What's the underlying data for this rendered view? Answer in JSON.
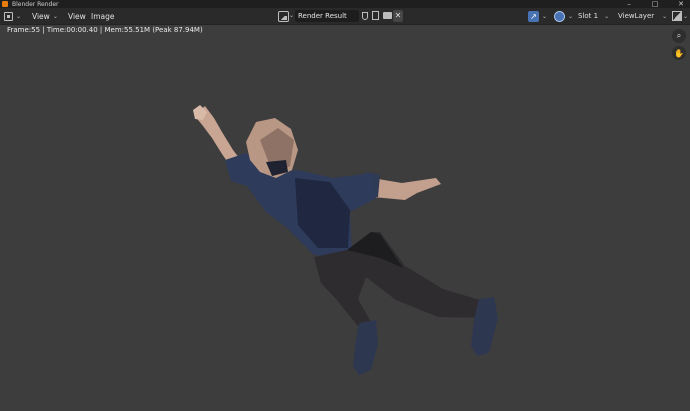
{
  "window": {
    "title": "Blender Render",
    "controls": [
      "–",
      "□",
      "✕"
    ]
  },
  "header": {
    "editor_type_icon": "image-editor-icon",
    "menus": [
      "View",
      "View",
      "Image"
    ],
    "image_name": "Render Result",
    "slot": "Slot 1",
    "view_layer": "ViewLayer",
    "chevron": "⌄",
    "close_glyph": "✕"
  },
  "render_info": {
    "stats": "Frame:55 | Time:00:00.40 | Mem:55.51M (Peak 87.94M)"
  },
  "viewport": {
    "zoom_glyph": "⌕",
    "pan_glyph": "✋"
  },
  "colors": {
    "background": "#3d3d3d",
    "accent": "#4772b3"
  }
}
